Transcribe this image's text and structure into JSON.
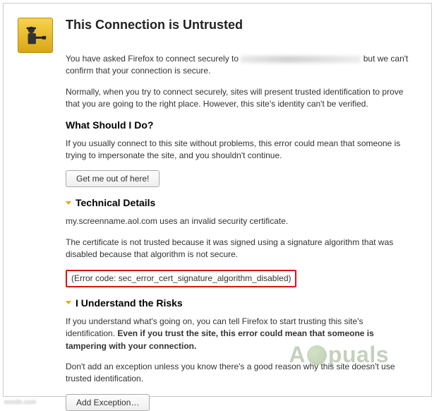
{
  "header": {
    "title": "This Connection is Untrusted",
    "intro_a": "You have asked Firefox to connect securely to ",
    "intro_b": " but we can't confirm that your connection is secure.",
    "para2": "Normally, when you try to connect securely, sites will present trusted identification to prove that you are going to the right place. However, this site's identity can't be verified."
  },
  "whatdo": {
    "heading": "What Should I Do?",
    "para": "If you usually connect to this site without problems, this error could mean that someone is trying to impersonate the site, and you shouldn't continue.",
    "button": "Get me out of here!"
  },
  "tech": {
    "heading": "Technical Details",
    "line1": "my.screenname.aol.com uses an invalid security certificate.",
    "line2": "The certificate is not trusted because it was signed using a signature algorithm that was disabled because that algorithm is not secure.",
    "error_code": "(Error code: sec_error_cert_signature_algorithm_disabled)"
  },
  "risks": {
    "heading": "I Understand the Risks",
    "para1a": "If you understand what's going on, you can tell Firefox to start trusting this site's identification. ",
    "para1b": "Even if you trust the site, this error could mean that someone is tampering with your connection.",
    "para2": "Don't add an exception unless you know there's a good reason why this site doesn't use trusted identification.",
    "button": "Add Exception…"
  },
  "watermark": {
    "pre": "A",
    "post": "puals"
  },
  "source": "wsxdn.com"
}
